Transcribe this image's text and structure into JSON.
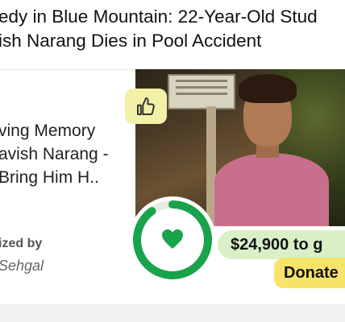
{
  "headline": {
    "line1": "edy in Blue Mountain: 22-Year-Old Stud",
    "line2": "ish Narang Dies in Pool Accident"
  },
  "fundraiser": {
    "title_line1": "ving Memory",
    "title_line2": "avish Narang -",
    "title_line3": "Bring Him H..",
    "organizer_label": "ized by",
    "organizer_name": "Sehgal",
    "amount": "$24,900 to g",
    "donate_label": "Donate",
    "progress_fraction": 0.9,
    "colors": {
      "progress": "#19a34a",
      "amount_bg": "#d9f0c7",
      "donate_bg": "#f6e36a",
      "badge_bg": "#f3f0a8"
    }
  },
  "icons": {
    "thumb": "thumbs-up-icon",
    "heart": "heart-icon"
  }
}
